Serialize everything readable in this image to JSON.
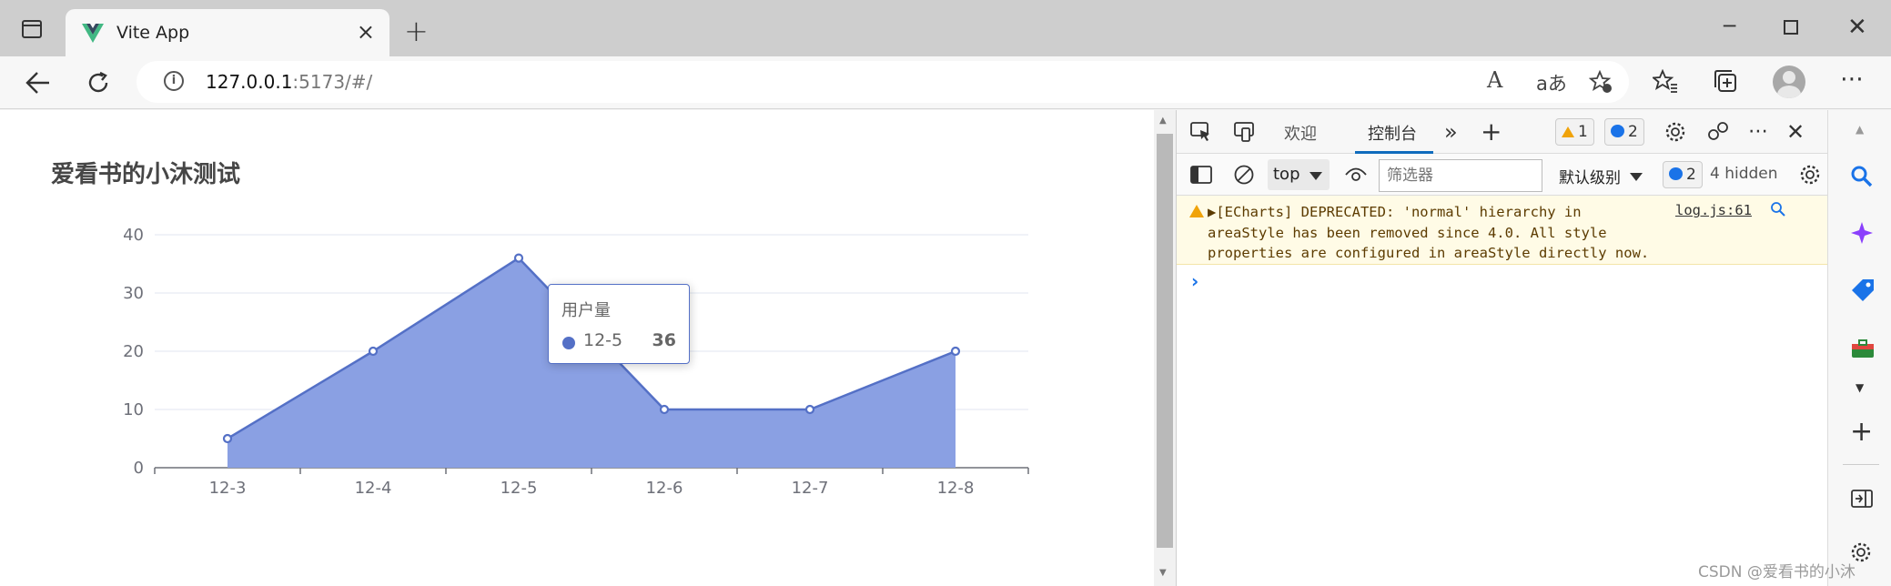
{
  "browser": {
    "tab_title": "Vite App",
    "tab_close": "×",
    "new_tab": "+",
    "window_controls": {
      "minimize": "─",
      "maximize": "",
      "close": "✕"
    },
    "address": {
      "host": "127.0.0.1",
      "path": ":5173/#/"
    },
    "toolbar_icons": [
      "back-icon",
      "reload-icon",
      "read-aloud-icon",
      "translate-icon",
      "favorite-add-icon",
      "favorites-icon",
      "collections-icon",
      "profile-avatar",
      "more-icon"
    ],
    "read_aloud_label": "A",
    "translate_label": "aあ"
  },
  "page": {
    "title": "爱看书的小沐测试",
    "tooltip": {
      "series_name": "用户量",
      "category": "12-5",
      "value": "36"
    }
  },
  "chart_data": {
    "type": "area",
    "title": "爱看书的小沐测试",
    "categories": [
      "12-3",
      "12-4",
      "12-5",
      "12-6",
      "12-7",
      "12-8"
    ],
    "series": [
      {
        "values": [
          5,
          20,
          36,
          10,
          10,
          20
        ]
      }
    ],
    "ylim": [
      0,
      40
    ],
    "yticks": [
      "0",
      "10",
      "20",
      "30",
      "40"
    ],
    "grid": true,
    "color": "#5470c6",
    "area_color": "#8aa0e3"
  },
  "devtools": {
    "tabs": {
      "welcome": "欢迎",
      "console": "控制台",
      "more": "»",
      "add": "+"
    },
    "warnings_count": "1",
    "messages_count": "2",
    "context": "top",
    "filter_placeholder": "筛选器",
    "level": "默认级别",
    "issues_count": "2",
    "hidden": "4 hidden",
    "message": {
      "text": "▶[ECharts] DEPRECATED: 'normal' hierarchy in\nareaStyle has been removed since 4.0. All style\nproperties are configured in areaStyle directly now.",
      "source": "log.js:61"
    },
    "prompt": "›"
  },
  "watermark": "CSDN @爱看书的小沐"
}
